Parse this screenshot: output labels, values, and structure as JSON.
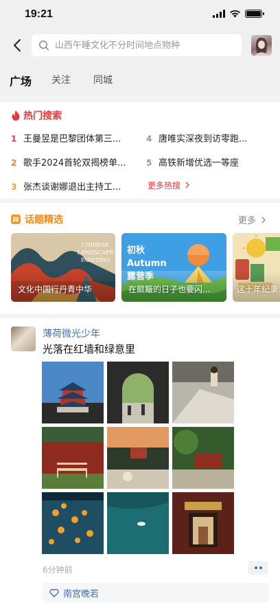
{
  "status": {
    "time": "19:21"
  },
  "search": {
    "placeholder": "山西午睡文化不分时间地点物种"
  },
  "tabs": [
    {
      "label": "广场",
      "active": true
    },
    {
      "label": "关注",
      "active": false
    },
    {
      "label": "同城",
      "active": false
    }
  ],
  "hot_search": {
    "title": "热门搜索",
    "items": [
      {
        "rank": "1",
        "text": "王曼昱是巴黎团体第三..."
      },
      {
        "rank": "2",
        "text": "歌手2024首轮双揭榜单..."
      },
      {
        "rank": "3",
        "text": "张杰谈谢娜退出主持工..."
      },
      {
        "rank": "4",
        "text": "唐唯实深夜到访零跑..."
      },
      {
        "rank": "5",
        "text": "高铁新增优选一等座"
      }
    ],
    "more": "更多热搜"
  },
  "topics": {
    "title": "话题精选",
    "more": "更多",
    "cards": [
      {
        "caption": "文化中国行丹青中华",
        "overlay": "CHINESE LANDSCAPE PAINTING"
      },
      {
        "caption": "在颠簸的日子也要闪...",
        "overlay": "初秋 Autumn 露营季"
      },
      {
        "caption": "这十年纪录"
      }
    ]
  },
  "post": {
    "author": "薄荷微光少年",
    "text": "光落在红墙和绿意里",
    "time": "6分钟前",
    "likes": "南宫晚若"
  },
  "colors": {
    "hot_red": "#e8393c",
    "topic_orange": "#f08b1d",
    "link_blue": "#496ea8"
  }
}
